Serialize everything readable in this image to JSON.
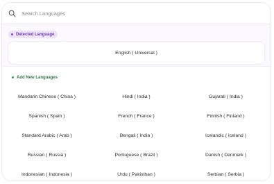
{
  "search": {
    "placeholder": "Search Languages",
    "icon": "search-icon"
  },
  "detected": {
    "badge_label": "Detected Language",
    "badge_color": "#7b4cc8",
    "language": "English ( Universal )"
  },
  "add": {
    "badge_label": "Add New Languages",
    "badge_color": "#3b9a5a",
    "languages": [
      "Mandarin Chinese ( China )",
      "Hindi ( India )",
      "Gujarati ( India )",
      "Spanish ( Spain )",
      "French ( France )",
      "Finnish ( Finland )",
      "Standard Arabic ( Arab )",
      "Bengali ( India )",
      "Icelandic ( Iceland )",
      "Russian ( Russia )",
      "Portuguese ( Brazil )",
      "Danish ( Denmark )",
      "Indonesian ( Indonesia )",
      "Urdu ( Pakisthan )",
      "Serbian ( Serbia )"
    ]
  }
}
